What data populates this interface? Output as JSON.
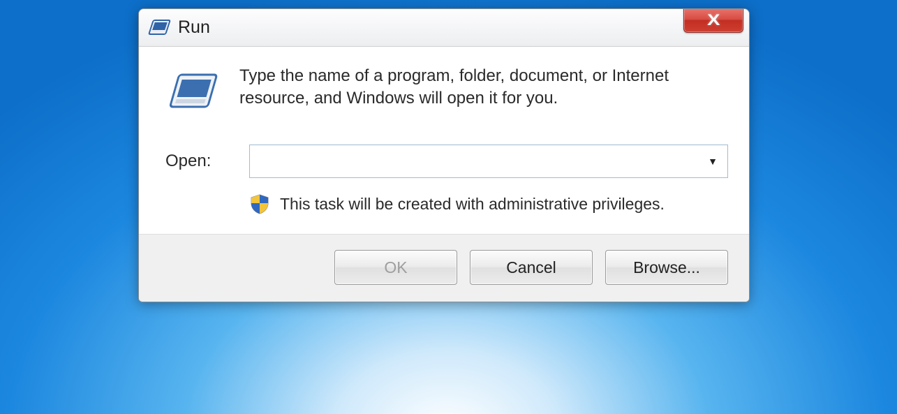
{
  "dialog": {
    "title": "Run",
    "description": "Type the name of a program, folder, document, or Internet resource, and Windows will open it for you.",
    "open_label": "Open:",
    "input_value": "",
    "admin_note": "This task will be created with administrative privileges.",
    "buttons": {
      "ok": "OK",
      "cancel": "Cancel",
      "browse": "Browse..."
    }
  }
}
